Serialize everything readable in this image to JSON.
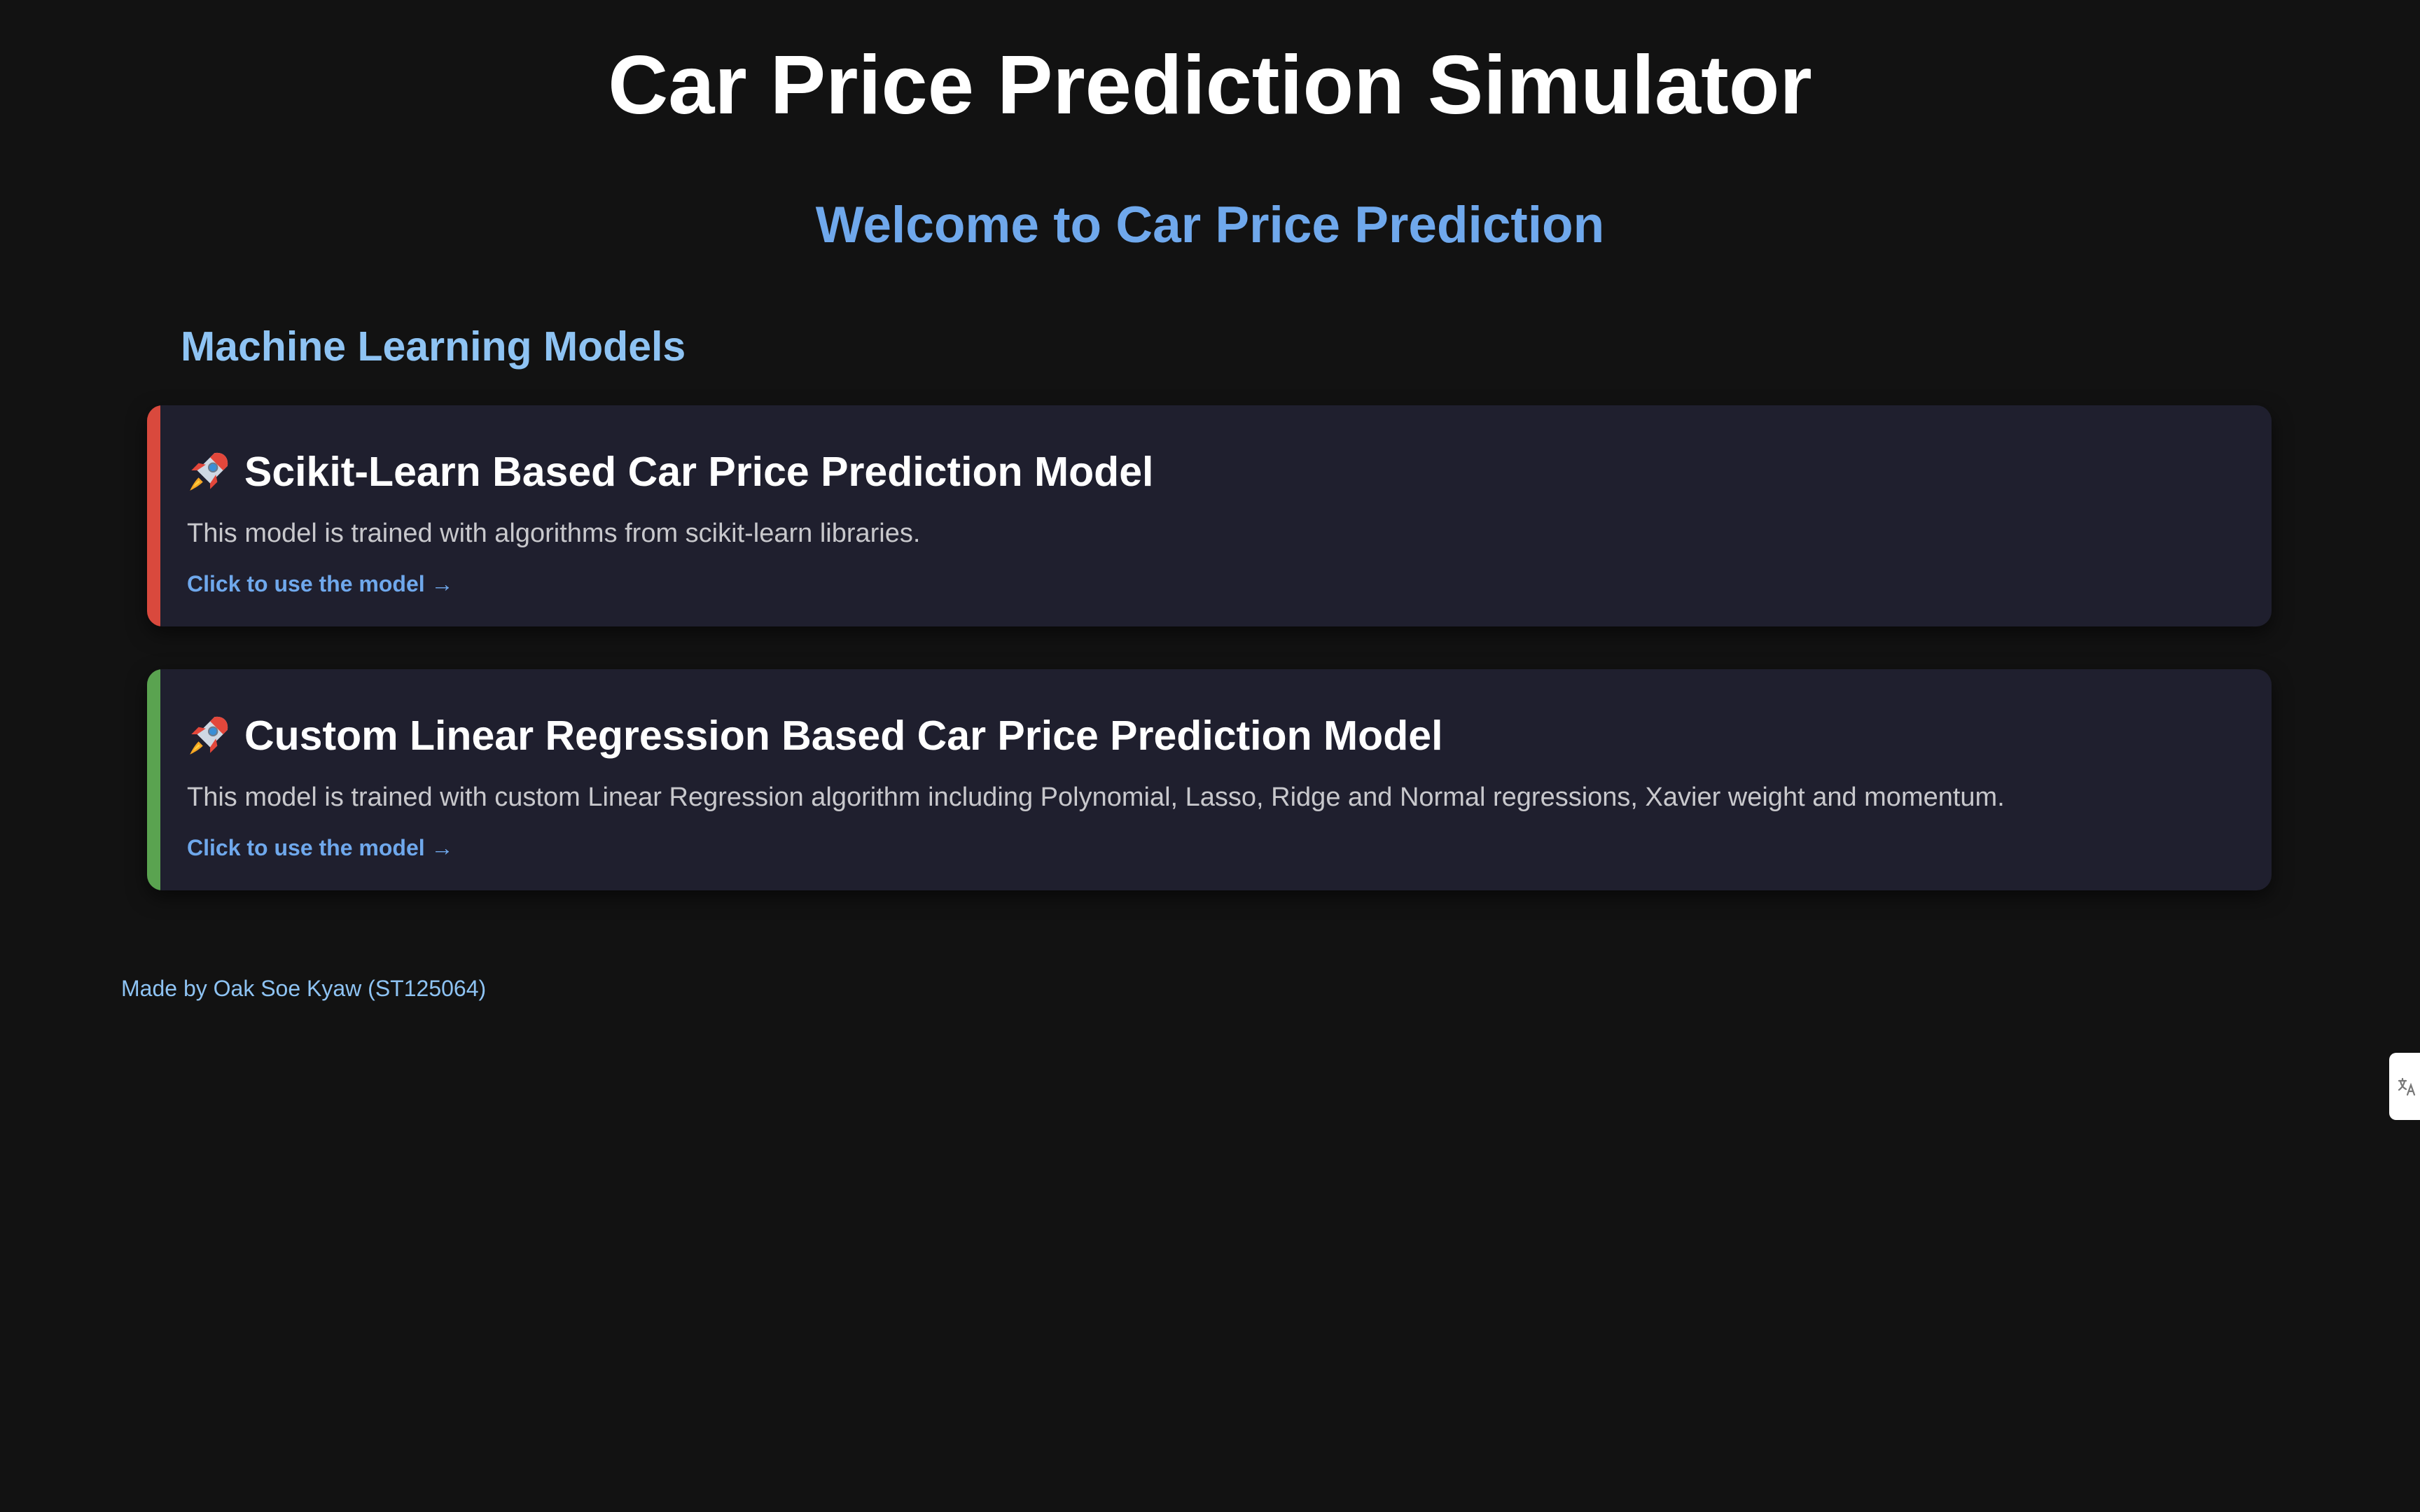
{
  "page": {
    "title": "Car Price Prediction Simulator",
    "welcome": "Welcome to Car Price Prediction",
    "section_title": "Machine Learning Models"
  },
  "models": [
    {
      "title": "Scikit-Learn Based Car Price Prediction Model",
      "description": "This model is trained with algorithms from scikit-learn libraries.",
      "link_label": "Click to use the model →",
      "accent_color": "#d9493d",
      "icon": "rocket-icon"
    },
    {
      "title": "Custom Linear Regression Based Car Price Prediction Model",
      "description": "This model is trained with custom Linear Regression algorithm including Polynomial, Lasso, Ridge and Normal regressions, Xavier weight and momentum.",
      "link_label": "Click to use the model →",
      "accent_color": "#5aa350",
      "icon": "rocket-icon"
    }
  ],
  "footer": {
    "credit": "Made by Oak Soe Kyaw (ST125064)"
  },
  "colors": {
    "background": "#121212",
    "card_background": "#1f1f2e",
    "accent_blue": "#6fa8ec",
    "light_blue": "#8ec3f3"
  }
}
